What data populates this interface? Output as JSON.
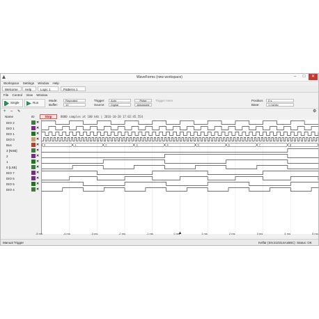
{
  "window": {
    "title": "WaveForms  (new workspace)",
    "minimize_glyph": "–",
    "maximize_glyph": "□",
    "close_glyph": "✕"
  },
  "menu": [
    "Workspace",
    "Settings",
    "Window",
    "Help"
  ],
  "tabs": {
    "welcome": "Welcome",
    "help": "Help",
    "logic": "Logic 1",
    "patterns": "Patterns 1"
  },
  "submenu": [
    "File",
    "Control",
    "View",
    "Window"
  ],
  "toolbar": {
    "single_label": "Single",
    "run_label": "Run",
    "mode_label": "Mode:",
    "mode_value": "Repeated",
    "buffer_label": "Buffer:",
    "buffer_value": "10",
    "trigger_label": "Trigger:",
    "trigger_value": "Auto",
    "source_label": "Source:",
    "source_value": "Digital",
    "pulse_label": "Pulse",
    "advanced_label": "Advanced",
    "trigger_hint": "Trigger Here",
    "position_label": "Position:",
    "position_value": "0 s",
    "base_label": "Base:",
    "base_value": "1 ms/div"
  },
  "acq": {
    "stop_label": "Stop",
    "status_text": "8000 samples at 100 kHz | 2016-10-20 17:02:45.554"
  },
  "columns": {
    "name": "Name",
    "id": "ID"
  },
  "signals": [
    {
      "name": "DIO 2",
      "color": "#3d7a3d"
    },
    {
      "name": "DIO 1",
      "color": "#7a2a8a"
    },
    {
      "name": "DIO 1",
      "color": "#1a7a1a"
    },
    {
      "name": "DIO 0",
      "color": "#cf9b6a"
    },
    {
      "name": "Bus",
      "color": "#c0392b"
    },
    {
      "name": "3 [NSB]",
      "color": "#3d7a3d"
    },
    {
      "name": "2",
      "color": "#7a2a8a"
    },
    {
      "name": "1",
      "color": "#1a7a1a"
    },
    {
      "name": "0 [LSB]",
      "color": "#3d7a3d"
    },
    {
      "name": "DIO 7",
      "color": "#7a2a8a"
    },
    {
      "name": "DIO 6",
      "color": "#7a2a8a"
    },
    {
      "name": "DIO 5",
      "color": "#1a7a1a"
    },
    {
      "name": "DIO 4",
      "color": "#3d7a3d"
    }
  ],
  "bus_values": [
    "0",
    "1",
    "2",
    "3",
    "4",
    "5",
    "6",
    "7",
    "8"
  ],
  "time_ticks": [
    "-5 ms",
    "-4 ms",
    "-3 ms",
    "-2 ms",
    "-1 ms",
    "0 ms",
    "1 ms",
    "2 ms",
    "3 ms",
    "4 ms",
    "5 ms"
  ],
  "statusbar": {
    "left": "Manual Trigger",
    "device": "Kelfar (SN:210314A1B6C)",
    "status": "Status: OK"
  }
}
